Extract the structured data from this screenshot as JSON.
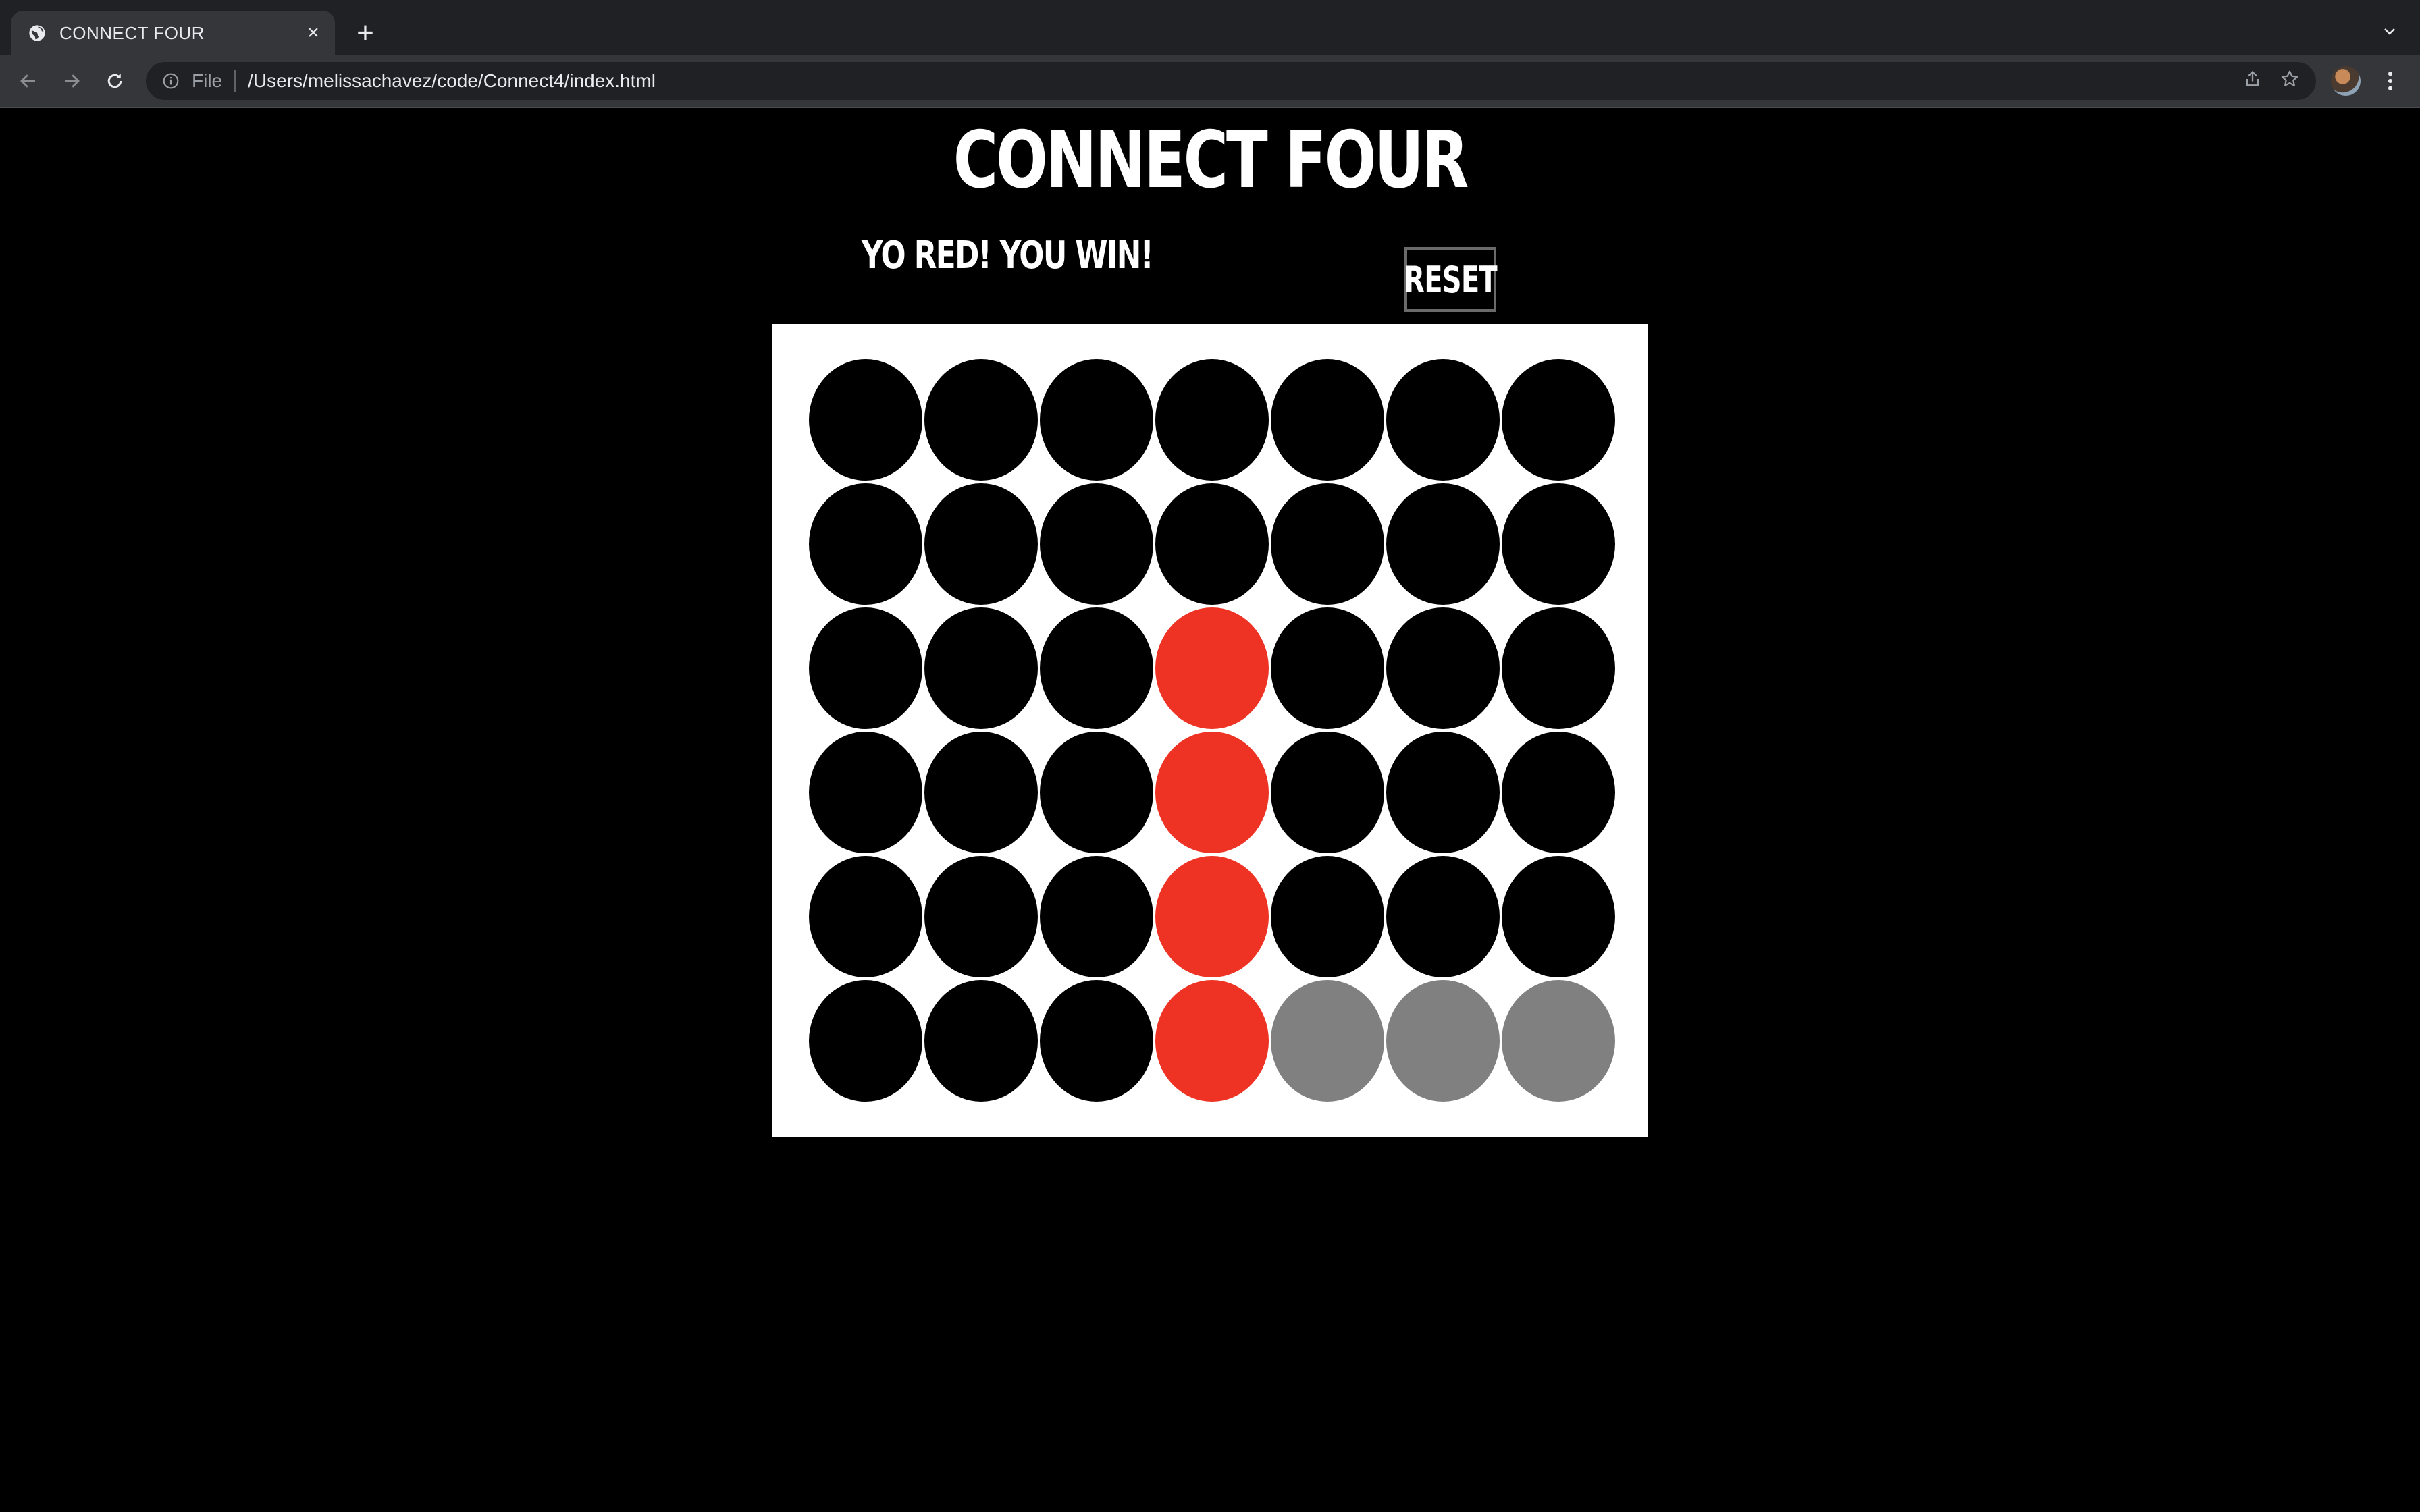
{
  "browser": {
    "tab_title": "CONNECT FOUR",
    "tab_close": "×",
    "new_tab": "+",
    "address_scheme": "File",
    "address_url": "/Users/melissachavez/code/Connect4/index.html"
  },
  "page": {
    "title": "CONNECT FOUR",
    "status_message": "YO RED! YOU WIN!",
    "reset_label": "RESET"
  },
  "colors": {
    "empty": "#000000",
    "red": "#ee3224",
    "gray": "#808080",
    "board": "#ffffff"
  },
  "board": {
    "rows": 6,
    "columns": 7,
    "cells": [
      [
        "empty",
        "empty",
        "empty",
        "empty",
        "empty",
        "empty",
        "empty"
      ],
      [
        "empty",
        "empty",
        "empty",
        "empty",
        "empty",
        "empty",
        "empty"
      ],
      [
        "empty",
        "empty",
        "empty",
        "red",
        "empty",
        "empty",
        "empty"
      ],
      [
        "empty",
        "empty",
        "empty",
        "red",
        "empty",
        "empty",
        "empty"
      ],
      [
        "empty",
        "empty",
        "empty",
        "red",
        "empty",
        "empty",
        "empty"
      ],
      [
        "empty",
        "empty",
        "empty",
        "red",
        "gray",
        "gray",
        "gray"
      ]
    ]
  }
}
